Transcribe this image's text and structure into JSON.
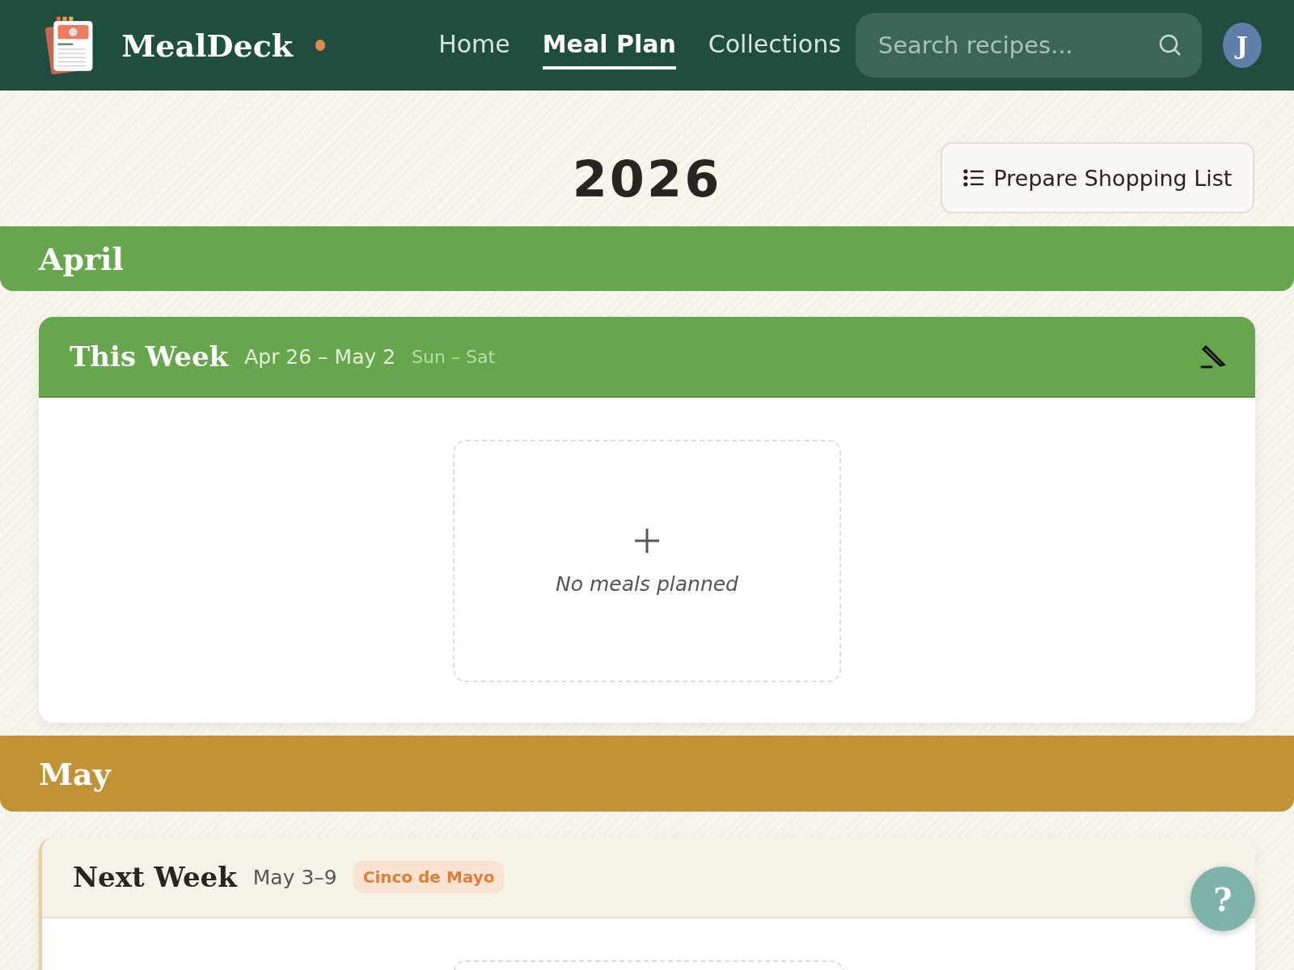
{
  "header": {
    "brand": "MealDeck",
    "status_dot": {
      "color": "#e08a4a"
    },
    "nav": [
      {
        "label": "Home",
        "selected": false
      },
      {
        "label": "Meal Plan",
        "selected": true
      },
      {
        "label": "Collections",
        "selected": false
      }
    ],
    "search": {
      "placeholder": "Search recipes..."
    },
    "avatar": "J"
  },
  "year": "2026",
  "shopping_button": "Prepare Shopping List",
  "months": [
    {
      "name": "April",
      "color": "#67a64c",
      "weeks": [
        {
          "title": "This Week",
          "range": "Apr 26 – May 2",
          "days": "Sun – Sat",
          "current": true,
          "empty_text": "No meals planned"
        }
      ]
    },
    {
      "name": "May",
      "color": "#c19336",
      "weeks": [
        {
          "title": "Next Week",
          "range": "May 3–9",
          "holiday": "Cinco de Mayo",
          "current": false
        }
      ]
    }
  ],
  "help_button": "?"
}
